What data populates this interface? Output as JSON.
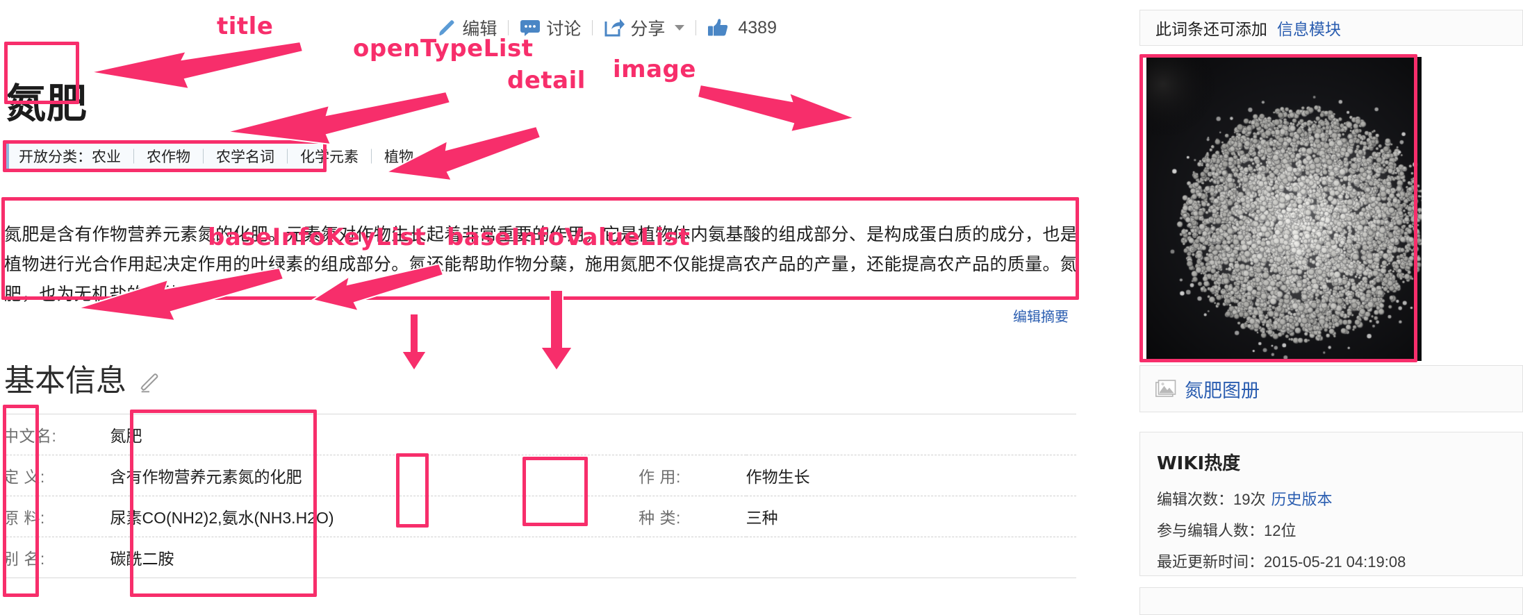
{
  "toolbar": {
    "edit_label": "编辑",
    "discuss_label": "讨论",
    "share_label": "分享",
    "like_count": "4389"
  },
  "title": "氮肥",
  "open_type_list": {
    "label": "开放分类：",
    "items": [
      "农业",
      "农作物",
      "农学名词",
      "化学元素",
      "植物"
    ],
    "separator": "｜"
  },
  "detail": "氮肥是含有作物营养元素氮的化肥。元素氮对作物生长起着非常重要的作用，它是植物体内氨基酸的组成部分、是构成蛋白质的成分，也是植物进行光合作用起决定作用的叶绿素的组成部分。氮还能帮助作物分蘖，施用氮肥不仅能提高农产品的产量，还能提高农产品的质量。氮肥，也为无机盐的一种。",
  "edit_summary_label": "编辑摘要",
  "baseinfo": {
    "heading": "基本信息",
    "rows": [
      {
        "k1": "中文名:",
        "v1": "氮肥",
        "k2": "",
        "v2": ""
      },
      {
        "k1": "定 义:",
        "v1": "含有作物营养元素氮的化肥",
        "k2": "作 用:",
        "v2": "作物生长"
      },
      {
        "k1": "原 料:",
        "v1": "尿素CO(NH2)2,氨水(NH3.H2O)",
        "k2": "种 类:",
        "v2": "三种"
      },
      {
        "k1": "别 名:",
        "v1": "碳酰二胺",
        "k2": "",
        "v2": ""
      }
    ]
  },
  "sidebar": {
    "info_module_text": "此词条还可添加",
    "info_module_link": "信息模块",
    "album_label": "氮肥图册",
    "wiki": {
      "title": "WIKI热度",
      "edit_count_label": "编辑次数：",
      "edit_count_value": "19次",
      "history_link": "历史版本",
      "editors_label": "参与编辑人数：",
      "editors_value": "12位",
      "updated_label": "最近更新时间：",
      "updated_value": "2015-05-21 04:19:08"
    }
  },
  "annotations": {
    "title": "title",
    "open_type_list": "openTypeList",
    "detail": "detail",
    "image": "image",
    "base_info_key_list": "baseInfoKeyList",
    "base_info_value_list": "baseInfoValueList"
  },
  "colors": {
    "annotation": "#F72E6B",
    "link": "#2a5db0",
    "icon_blue": "#5b9bd5"
  }
}
